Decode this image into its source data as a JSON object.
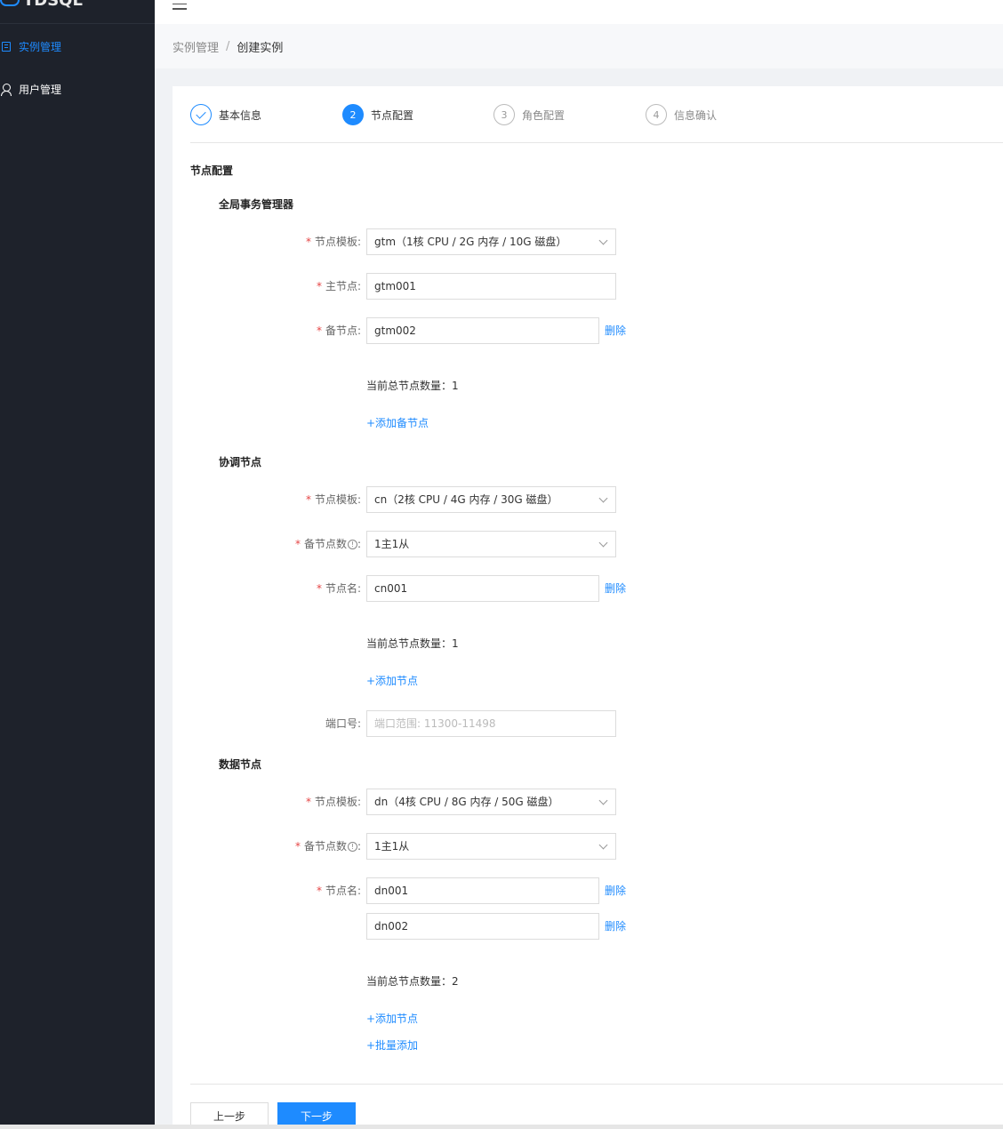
{
  "app": {
    "logo_text": "TDSQL"
  },
  "sidebar": {
    "items": [
      {
        "label": "实例管理",
        "icon": "list-icon",
        "active": true
      },
      {
        "label": "用户管理",
        "icon": "user-icon",
        "active": false
      }
    ]
  },
  "breadcrumb": {
    "parent": "实例管理",
    "separator": "/",
    "current": "创建实例"
  },
  "steps": [
    {
      "number": "1",
      "label": "基本信息",
      "state": "done"
    },
    {
      "number": "2",
      "label": "节点配置",
      "state": "active"
    },
    {
      "number": "3",
      "label": "角色配置",
      "state": "todo"
    },
    {
      "number": "4",
      "label": "信息确认",
      "state": "todo"
    }
  ],
  "section_title": "节点配置",
  "gtm": {
    "title": "全局事务管理器",
    "template_label": "节点模板",
    "template_value": "gtm（1核 CPU / 2G 内存 / 10G 磁盘）",
    "master_label": "主节点",
    "master_value": "gtm001",
    "backup_label": "备节点",
    "backup_value": "gtm002",
    "delete_label": "删除",
    "count_text": "当前总节点数量：1",
    "add_link": "+添加备节点"
  },
  "cn": {
    "title": "协调节点",
    "template_label": "节点模板",
    "template_value": "cn（2核 CPU / 4G 内存 / 30G 磁盘）",
    "replica_label": "备节点数",
    "replica_value": "1主1从",
    "node_label": "节点名",
    "node_value": "cn001",
    "delete_label": "删除",
    "count_text": "当前总节点数量：1",
    "add_link": "+添加节点",
    "port_label": "端口号",
    "port_placeholder": "端口范围: 11300-11498"
  },
  "dn": {
    "title": "数据节点",
    "template_label": "节点模板",
    "template_value": "dn（4核 CPU / 8G 内存 / 50G 磁盘）",
    "replica_label": "备节点数",
    "replica_value": "1主1从",
    "node_label": "节点名",
    "node_values": [
      "dn001",
      "dn002"
    ],
    "delete_label": "删除",
    "count_text": "当前总节点数量：2",
    "add_link": "+添加节点",
    "batch_link": "+批量添加"
  },
  "footer": {
    "prev_label": "上一步",
    "next_label": "下一步"
  },
  "colors": {
    "primary": "#1e8bff",
    "sidebar_bg": "#1e222b",
    "required": "#e54545"
  }
}
